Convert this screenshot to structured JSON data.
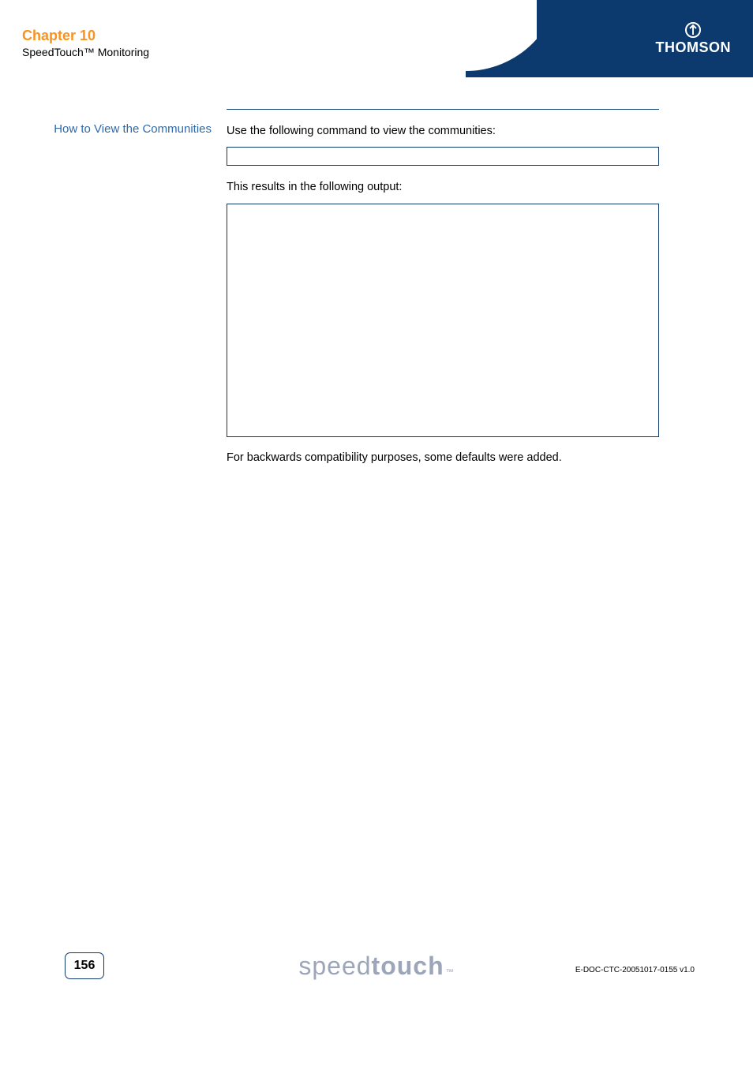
{
  "header": {
    "chapter_title": "Chapter 10",
    "chapter_subtitle": "SpeedTouch™ Monitoring",
    "brand": "THOMSON"
  },
  "section": {
    "heading": "How to View the Communities",
    "text1": "Use the following command to view the communities:",
    "text2": "This results in the following output:",
    "text3": "For backwards compatibility purposes, some defaults were added."
  },
  "footer": {
    "page_number": "156",
    "logo_light": "speed",
    "logo_bold": "touch",
    "logo_tm": "™",
    "doc_id": "E-DOC-CTC-20051017-0155 v1.0"
  }
}
